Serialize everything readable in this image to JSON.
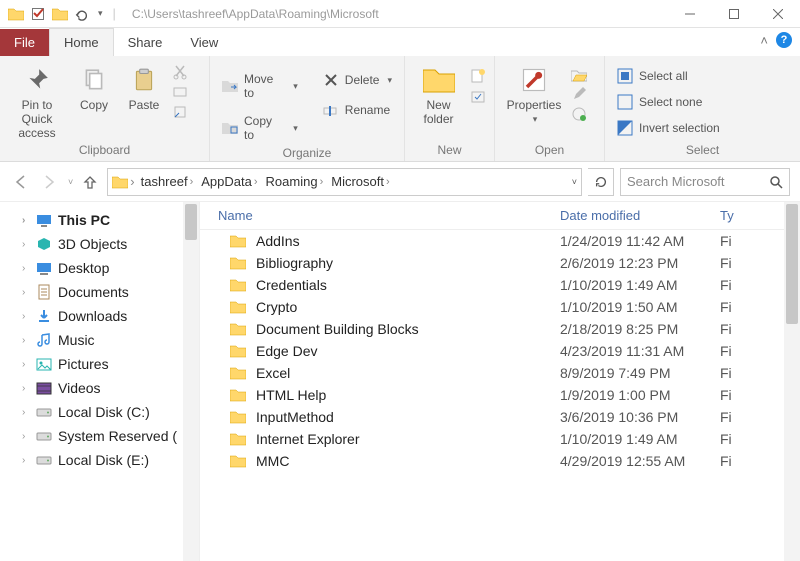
{
  "title_path": "C:\\Users\\tashreef\\AppData\\Roaming\\Microsoft",
  "tabs": {
    "file": "File",
    "home": "Home",
    "share": "Share",
    "view": "View"
  },
  "ribbon": {
    "clipboard": {
      "label": "Clipboard",
      "pin": "Pin to Quick access",
      "copy": "Copy",
      "paste": "Paste"
    },
    "organize": {
      "label": "Organize",
      "move": "Move to",
      "copy": "Copy to",
      "delete": "Delete",
      "rename": "Rename"
    },
    "new": {
      "label": "New",
      "newfolder": "New folder"
    },
    "open": {
      "label": "Open",
      "properties": "Properties"
    },
    "select": {
      "label": "Select",
      "all": "Select all",
      "none": "Select none",
      "invert": "Invert selection"
    }
  },
  "breadcrumbs": [
    "tashreef",
    "AppData",
    "Roaming",
    "Microsoft"
  ],
  "search_placeholder": "Search Microsoft",
  "tree": [
    {
      "label": "This PC",
      "icon": "pc",
      "bold": true
    },
    {
      "label": "3D Objects",
      "icon": "3d"
    },
    {
      "label": "Desktop",
      "icon": "desktop"
    },
    {
      "label": "Documents",
      "icon": "doc"
    },
    {
      "label": "Downloads",
      "icon": "dl"
    },
    {
      "label": "Music",
      "icon": "music"
    },
    {
      "label": "Pictures",
      "icon": "pic"
    },
    {
      "label": "Videos",
      "icon": "vid"
    },
    {
      "label": "Local Disk (C:)",
      "icon": "disk"
    },
    {
      "label": "System Reserved (",
      "icon": "disk"
    },
    {
      "label": "Local Disk (E:)",
      "icon": "disk"
    }
  ],
  "columns": {
    "name": "Name",
    "date": "Date modified",
    "type": "Ty"
  },
  "rows": [
    {
      "name": "AddIns",
      "date": "1/24/2019 11:42 AM",
      "type": "Fi"
    },
    {
      "name": "Bibliography",
      "date": "2/6/2019 12:23 PM",
      "type": "Fi"
    },
    {
      "name": "Credentials",
      "date": "1/10/2019 1:49 AM",
      "type": "Fi"
    },
    {
      "name": "Crypto",
      "date": "1/10/2019 1:50 AM",
      "type": "Fi"
    },
    {
      "name": "Document Building Blocks",
      "date": "2/18/2019 8:25 PM",
      "type": "Fi"
    },
    {
      "name": "Edge Dev",
      "date": "4/23/2019 11:31 AM",
      "type": "Fi"
    },
    {
      "name": "Excel",
      "date": "8/9/2019 7:49 PM",
      "type": "Fi"
    },
    {
      "name": "HTML Help",
      "date": "1/9/2019 1:00 PM",
      "type": "Fi"
    },
    {
      "name": "InputMethod",
      "date": "3/6/2019 10:36 PM",
      "type": "Fi"
    },
    {
      "name": "Internet Explorer",
      "date": "1/10/2019 1:49 AM",
      "type": "Fi"
    },
    {
      "name": "MMC",
      "date": "4/29/2019 12:55 AM",
      "type": "Fi"
    }
  ]
}
